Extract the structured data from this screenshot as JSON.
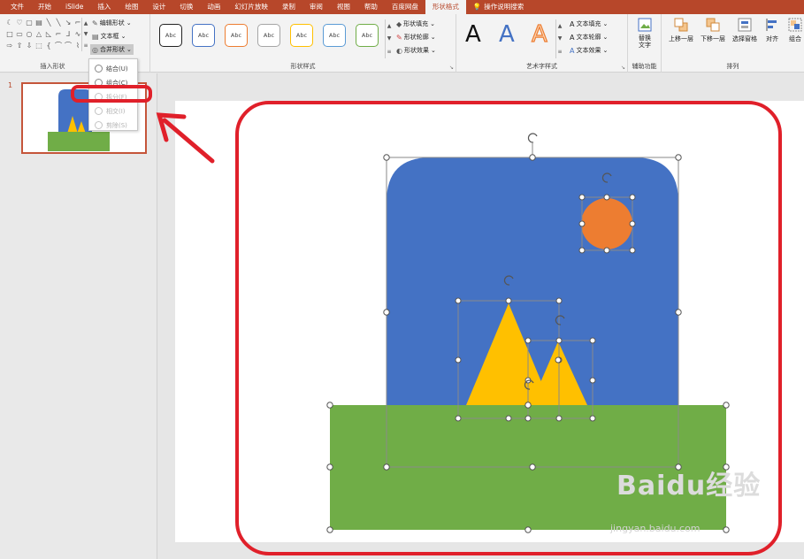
{
  "tabs": [
    "文件",
    "开始",
    "iSlide",
    "插入",
    "绘图",
    "设计",
    "切换",
    "动画",
    "幻灯片放映",
    "录制",
    "审阅",
    "视图",
    "帮助",
    "百度网盘",
    "形状格式"
  ],
  "tab_active": "形状格式",
  "tell_me": "操作说明搜索",
  "ribbon": {
    "insert_shapes": {
      "label": "插入形状",
      "edit_shape": "编辑形状",
      "text_box": "文本框",
      "merge_shapes": "合并形状"
    },
    "shape_styles": {
      "label": "形状样式",
      "presets": [
        "Abc",
        "Abc",
        "Abc",
        "Abc",
        "Abc",
        "Abc",
        "Abc"
      ],
      "fill": "形状填充",
      "outline": "形状轮廓",
      "effects": "形状效果"
    },
    "wordart_styles": {
      "label": "艺术字样式",
      "letters": [
        "A",
        "A",
        "A"
      ],
      "text_fill": "文本填充",
      "text_outline": "文本轮廓",
      "text_effects": "文本效果"
    },
    "accessibility": {
      "label": "辅助功能",
      "alt_text": "替换\n文字"
    },
    "arrange": {
      "label": "排列",
      "bring_forward": "上移一层",
      "send_backward": "下移一层",
      "selection_pane": "选择窗格",
      "align": "对齐",
      "group": "组合"
    }
  },
  "merge_menu": {
    "items": [
      {
        "label": "结合(U)",
        "enabled": true
      },
      {
        "label": "组合(C)",
        "enabled": true
      },
      {
        "label": "拆分(F)",
        "enabled": false
      },
      {
        "label": "相交(I)",
        "enabled": false
      },
      {
        "label": "剪除(S)",
        "enabled": false
      }
    ]
  },
  "slide_panel": {
    "slide_number": "1"
  },
  "watermark": {
    "logo": "Baidu经验",
    "url": "jingyan.baidu.com"
  },
  "colors": {
    "accent": "#b7472a",
    "highlight_red": "#e0202a",
    "sky_blue": "#4472c4",
    "sun_orange": "#ed7d31",
    "mountain_yellow": "#ffc000",
    "grass_green": "#70ad47"
  }
}
